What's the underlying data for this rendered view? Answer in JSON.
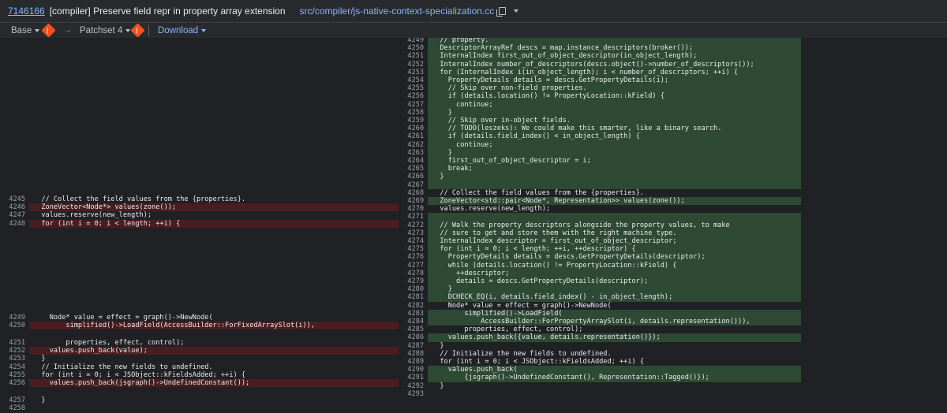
{
  "header": {
    "change_number": "7146166",
    "subject": "[compiler] Preserve field repr in property array extension",
    "file_path": "src/compiler/js-native-context-specialization.cc"
  },
  "toolbar": {
    "base_label": "Base",
    "patchset_label": "Patchset 4",
    "download_label": "Download"
  },
  "colors": {
    "background": "#202124",
    "deletion": "#4a1d20",
    "insertion": "#2e4a34",
    "link": "#8ab4f8"
  },
  "left_lines": [
    {
      "n": "4245",
      "t": "  // Collect the field values from the {properties}.",
      "k": "ctx"
    },
    {
      "n": "4246",
      "t": "  ZoneVector<Node*> values(zone());",
      "k": "del"
    },
    {
      "n": "4247",
      "t": "  values.reserve(new_length);",
      "k": "ctx"
    },
    {
      "n": "4248",
      "t": "  for (int i = 0; i < length; ++i) {",
      "k": "del"
    },
    {
      "n": "4249",
      "t": "    Node* value = effect = graph()->NewNode(",
      "k": "ctx"
    },
    {
      "n": "4250",
      "t": "        simplified()->LoadField(AccessBuilder::ForFixedArraySlot(i)),",
      "k": "del"
    },
    {
      "n": "4251",
      "t": "        properties, effect, control);",
      "k": "ctx"
    },
    {
      "n": "4252",
      "t": "    values.push_back(value);",
      "k": "del"
    },
    {
      "n": "4253",
      "t": "  }",
      "k": "ctx"
    },
    {
      "n": "4254",
      "t": "  // Initialize the new fields to undefined.",
      "k": "ctx"
    },
    {
      "n": "4255",
      "t": "  for (int i = 0; i < JSObject::kFieldsAdded; ++i) {",
      "k": "ctx"
    },
    {
      "n": "4256",
      "t": "    values.push_back(jsgraph()->UndefinedConstant());",
      "k": "del"
    },
    {
      "n": "4257",
      "t": "  }",
      "k": "ctx"
    },
    {
      "n": "4258",
      "t": "",
      "k": "ctx"
    }
  ],
  "right_lines": [
    {
      "n": "4249",
      "t": "  // property.",
      "k": "ins"
    },
    {
      "n": "4250",
      "t": "  DescriptorArrayRef descs = map.instance_descriptors(broker());",
      "k": "ins"
    },
    {
      "n": "4251",
      "t": "  InternalIndex first_out_of_object_descriptor(in_object_length);",
      "k": "ins"
    },
    {
      "n": "4252",
      "t": "  InternalIndex number_of_descriptors(descs.object()->number_of_descriptors());",
      "k": "ins"
    },
    {
      "n": "4253",
      "t": "  for (InternalIndex i(in_object_length); i < number_of_descriptors; ++i) {",
      "k": "ins"
    },
    {
      "n": "4254",
      "t": "    PropertyDetails details = descs.GetPropertyDetails(i);",
      "k": "ins"
    },
    {
      "n": "4255",
      "t": "    // Skip over non-field properties.",
      "k": "ins"
    },
    {
      "n": "4256",
      "t": "    if (details.location() != PropertyLocation::kField) {",
      "k": "ins"
    },
    {
      "n": "4257",
      "t": "      continue;",
      "k": "ins"
    },
    {
      "n": "4258",
      "t": "    }",
      "k": "ins"
    },
    {
      "n": "4259",
      "t": "    // Skip over in-object fields.",
      "k": "ins"
    },
    {
      "n": "4260",
      "t": "    // TODO(leszeks): We could make this smarter, like a binary search.",
      "k": "ins"
    },
    {
      "n": "4261",
      "t": "    if (details.field_index() < in_object_length) {",
      "k": "ins"
    },
    {
      "n": "4262",
      "t": "      continue;",
      "k": "ins"
    },
    {
      "n": "4263",
      "t": "    }",
      "k": "ins"
    },
    {
      "n": "4264",
      "t": "    first_out_of_object_descriptor = i;",
      "k": "ins"
    },
    {
      "n": "4265",
      "t": "    break;",
      "k": "ins"
    },
    {
      "n": "4266",
      "t": "  }",
      "k": "ins"
    },
    {
      "n": "4267",
      "t": "",
      "k": "ins"
    },
    {
      "n": "4268",
      "t": "  // Collect the field values from the {properties}.",
      "k": "ctx"
    },
    {
      "n": "4269",
      "t": "  ZoneVector<std::pair<Node*, Representation>> values(zone());",
      "k": "ins"
    },
    {
      "n": "4270",
      "t": "  values.reserve(new_length);",
      "k": "ctx"
    },
    {
      "n": "4271",
      "t": "",
      "k": "ins"
    },
    {
      "n": "4272",
      "t": "  // Walk the property descriptors alongside the property values, to make",
      "k": "ins"
    },
    {
      "n": "4273",
      "t": "  // sure to get and store them with the right machine type.",
      "k": "ins"
    },
    {
      "n": "4274",
      "t": "  InternalIndex descriptor = first_out_of_object_descriptor;",
      "k": "ins"
    },
    {
      "n": "4275",
      "t": "  for (int i = 0; i < length; ++i, ++descriptor) {",
      "k": "ins"
    },
    {
      "n": "4276",
      "t": "    PropertyDetails details = descs.GetPropertyDetails(descriptor);",
      "k": "ins"
    },
    {
      "n": "4277",
      "t": "    while (details.location() != PropertyLocation::kField) {",
      "k": "ins"
    },
    {
      "n": "4278",
      "t": "      ++descriptor;",
      "k": "ins"
    },
    {
      "n": "4279",
      "t": "      details = descs.GetPropertyDetails(descriptor);",
      "k": "ins"
    },
    {
      "n": "4280",
      "t": "    }",
      "k": "ins"
    },
    {
      "n": "4281",
      "t": "    DCHECK_EQ(i, details.field_index() - in_object_length);",
      "k": "ins"
    },
    {
      "n": "4282",
      "t": "    Node* value = effect = graph()->NewNode(",
      "k": "ctx"
    },
    {
      "n": "4283",
      "t": "        simplified()->LoadField(",
      "k": "ins"
    },
    {
      "n": "4284",
      "t": "            AccessBuilder::ForPropertyArraySlot(i, details.representation())),",
      "k": "ins"
    },
    {
      "n": "4285",
      "t": "        properties, effect, control);",
      "k": "ctx"
    },
    {
      "n": "4286",
      "t": "    values.push_back({value, details.representation()});",
      "k": "ins"
    },
    {
      "n": "4287",
      "t": "  }",
      "k": "ctx"
    },
    {
      "n": "4288",
      "t": "  // Initialize the new fields to undefined.",
      "k": "ctx"
    },
    {
      "n": "4289",
      "t": "  for (int i = 0; i < JSObject::kFieldsAdded; ++i) {",
      "k": "ctx"
    },
    {
      "n": "4290",
      "t": "    values.push_back(",
      "k": "ins"
    },
    {
      "n": "4291",
      "t": "        {jsgraph()->UndefinedConstant(), Representation::Tagged()});",
      "k": "ins"
    },
    {
      "n": "4292",
      "t": "  }",
      "k": "ctx"
    },
    {
      "n": "4293",
      "t": "",
      "k": "ctx"
    }
  ]
}
